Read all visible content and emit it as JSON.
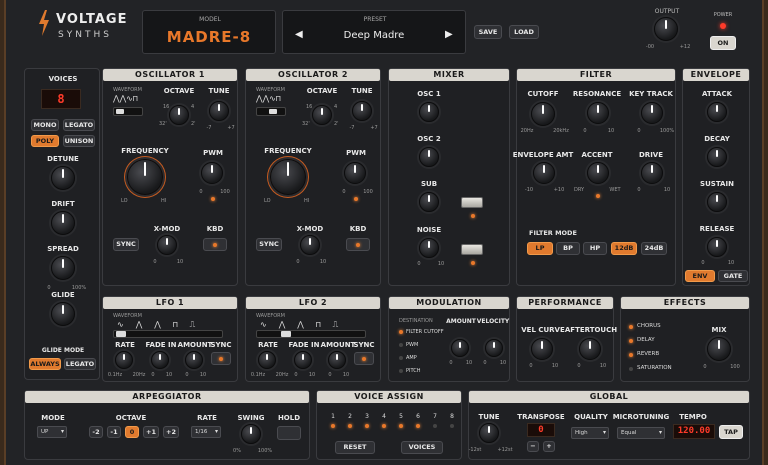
{
  "brand": {
    "name": "VOLTAGE",
    "sub": "SYNTHS"
  },
  "header": {
    "model_label": "MODEL",
    "model": "MADRE-8",
    "preset_label": "PRESET",
    "preset": "Deep Madre",
    "save": "SAVE",
    "load": "LOAD",
    "output_label": "OUTPUT",
    "out_min": "-00",
    "out_max": "+12",
    "power_label": "POWER",
    "power_btn": "ON"
  },
  "voices": {
    "title": "VOICES",
    "count": "8",
    "mono": "MONO",
    "legato": "LEGATO",
    "poly": "POLY",
    "unison": "UNISON",
    "detune": "DETUNE",
    "drift": "DRIFT",
    "spread": "SPREAD",
    "glide": "GLIDE",
    "glide_min": "0",
    "glide_max": "100%",
    "glide_mode": "GLIDE MODE",
    "always": "ALWAYS",
    "legato2": "LEGATO"
  },
  "osc1": {
    "title": "OSCILLATOR 1",
    "waveform": "WAVEFORM",
    "octave": "OCTAVE",
    "tune": "TUNE",
    "oct_min": "16",
    "oct_max": "4",
    "oct_lo": "32'",
    "oct_hi": "2'",
    "tune_min": "-7",
    "tune_max": "+7",
    "frequency": "FREQUENCY",
    "lo": "LO",
    "hi": "HI",
    "pwm": "PWM",
    "pwm_min": "0",
    "pwm_max": "100",
    "xmod": "X-MOD",
    "xmod_min": "0",
    "xmod_max": "10",
    "kbd": "KBD",
    "sync": "SYNC"
  },
  "osc2": {
    "title": "OSCILLATOR 2",
    "waveform": "WAVEFORM",
    "octave": "OCTAVE",
    "tune": "TUNE",
    "oct_min": "16",
    "oct_max": "4",
    "oct_lo": "32'",
    "oct_hi": "2'",
    "tune_min": "-7",
    "tune_max": "+7",
    "frequency": "FREQUENCY",
    "lo": "LO",
    "hi": "HI",
    "pwm": "PWM",
    "pwm_min": "0",
    "pwm_max": "100",
    "xmod": "X-MOD",
    "xmod_min": "0",
    "xmod_max": "10",
    "kbd": "KBD",
    "sync": "SYNC"
  },
  "mixer": {
    "title": "MIXER",
    "osc1": "OSC 1",
    "osc2": "OSC 2",
    "sub": "SUB",
    "noise": "NOISE",
    "min": "0",
    "max": "10"
  },
  "filter": {
    "title": "FILTER",
    "cutoff": "CUTOFF",
    "resonance": "RESONANCE",
    "keytrack": "KEY TRACK",
    "cut_min": "20Hz",
    "cut_max": "20kHz",
    "res_min": "0",
    "res_max": "10",
    "kt_min": "0",
    "kt_max": "100%",
    "env_amt": "ENVELOPE AMT",
    "accent": "ACCENT",
    "drive": "DRIVE",
    "env_min": "-10",
    "env_max": "+10",
    "acc_min": "DRY",
    "acc_max": "WET",
    "drv_min": "0",
    "drv_max": "10",
    "mode": "FILTER MODE",
    "lp": "LP",
    "bp": "BP",
    "hp": "HP",
    "db12": "12dB",
    "db24": "24dB"
  },
  "envelope": {
    "title": "ENVELOPE",
    "attack": "ATTACK",
    "decay": "DECAY",
    "sustain": "SUSTAIN",
    "release": "RELEASE",
    "min": "0",
    "max": "10",
    "env": "ENV",
    "gate": "GATE"
  },
  "lfo1": {
    "title": "LFO 1",
    "waveform": "WAVEFORM",
    "rate": "RATE",
    "fadein": "FADE IN",
    "amount": "AMOUNT",
    "sync": "SYNC",
    "rate_min": "0.1Hz",
    "rate_max": "20Hz",
    "min": "0",
    "max": "10"
  },
  "lfo2": {
    "title": "LFO 2",
    "waveform": "WAVEFORM",
    "rate": "RATE",
    "fadein": "FADE IN",
    "amount": "AMOUNT",
    "sync": "SYNC",
    "rate_min": "0.1Hz",
    "rate_max": "20Hz",
    "min": "0",
    "max": "10"
  },
  "modulation": {
    "title": "MODULATION",
    "destination": "DESTINATION",
    "amount": "AMOUNT",
    "velocity": "VELOCITY",
    "dest": [
      "FILTER CUTOFF",
      "PWM",
      "AMP",
      "PITCH"
    ],
    "min": "0",
    "max": "10"
  },
  "performance": {
    "title": "PERFORMANCE",
    "velcurve": "VEL CURVE",
    "aftertouch": "AFTERTOUCH",
    "min": "0",
    "max": "10"
  },
  "effects": {
    "title": "EFFECTS",
    "items": [
      "CHORUS",
      "DELAY",
      "REVERB",
      "SATURATION"
    ],
    "mix": "MIX",
    "min": "0",
    "max": "100"
  },
  "arp": {
    "title": "ARPEGGIATOR",
    "mode": "MODE",
    "mode_val": "UP",
    "octave": "OCTAVE",
    "oct": [
      "-2",
      "-1",
      "0",
      "+1",
      "+2"
    ],
    "rate": "RATE",
    "rate_val": "1/16",
    "swing": "SWING",
    "sw_min": "0%",
    "sw_max": "100%",
    "hold": "HOLD"
  },
  "voiceassign": {
    "title": "VOICE ASSIGN",
    "nums": [
      "1",
      "2",
      "3",
      "4",
      "5",
      "6",
      "7",
      "8"
    ],
    "reset": "RESET",
    "voices": "VOICES"
  },
  "global": {
    "title": "GLOBAL",
    "tune": "TUNE",
    "tune_min": "-12st",
    "tune_max": "+12st",
    "transpose": "TRANSPOSE",
    "transpose_val": "0",
    "minus": "−",
    "plus": "+",
    "quality": "QUALITY",
    "quality_val": "High",
    "microtuning": "MICROTUNING",
    "micro_val": "Equal",
    "tempo": "TEMPO",
    "tempo_val": "120.00",
    "tap": "TAP"
  },
  "colors": {
    "accent": "#e07a2e",
    "panel": "#1f2023",
    "title_bar": "#d9d6cf",
    "display_red": "#ff3b2a"
  }
}
